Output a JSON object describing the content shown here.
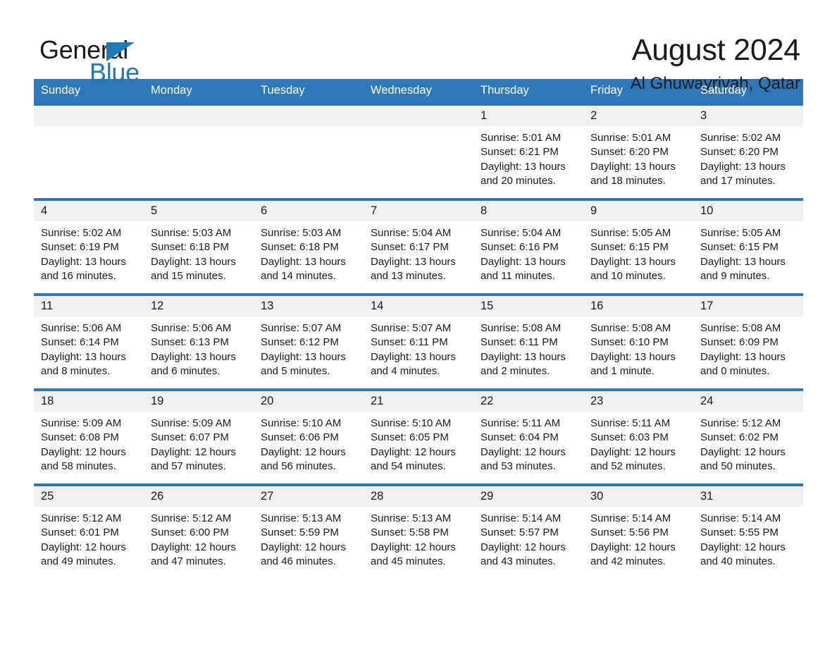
{
  "brand": {
    "name_top": "General",
    "name_bottom": "Blue",
    "accent_color": "#1f78b8"
  },
  "header": {
    "month_title": "August 2024",
    "location": "Al Ghuwayriyah, Qatar"
  },
  "calendar": {
    "header_bg": "#2e77b8",
    "header_text_color": "#ffffff",
    "daynum_bg": "#f0f0f0",
    "weekday_headers": [
      "Sunday",
      "Monday",
      "Tuesday",
      "Wednesday",
      "Thursday",
      "Friday",
      "Saturday"
    ],
    "weeks": [
      [
        {
          "day": "",
          "sunrise": "",
          "sunset": "",
          "daylight": ""
        },
        {
          "day": "",
          "sunrise": "",
          "sunset": "",
          "daylight": ""
        },
        {
          "day": "",
          "sunrise": "",
          "sunset": "",
          "daylight": ""
        },
        {
          "day": "",
          "sunrise": "",
          "sunset": "",
          "daylight": ""
        },
        {
          "day": "1",
          "sunrise": "Sunrise: 5:01 AM",
          "sunset": "Sunset: 6:21 PM",
          "daylight": "Daylight: 13 hours and 20 minutes."
        },
        {
          "day": "2",
          "sunrise": "Sunrise: 5:01 AM",
          "sunset": "Sunset: 6:20 PM",
          "daylight": "Daylight: 13 hours and 18 minutes."
        },
        {
          "day": "3",
          "sunrise": "Sunrise: 5:02 AM",
          "sunset": "Sunset: 6:20 PM",
          "daylight": "Daylight: 13 hours and 17 minutes."
        }
      ],
      [
        {
          "day": "4",
          "sunrise": "Sunrise: 5:02 AM",
          "sunset": "Sunset: 6:19 PM",
          "daylight": "Daylight: 13 hours and 16 minutes."
        },
        {
          "day": "5",
          "sunrise": "Sunrise: 5:03 AM",
          "sunset": "Sunset: 6:18 PM",
          "daylight": "Daylight: 13 hours and 15 minutes."
        },
        {
          "day": "6",
          "sunrise": "Sunrise: 5:03 AM",
          "sunset": "Sunset: 6:18 PM",
          "daylight": "Daylight: 13 hours and 14 minutes."
        },
        {
          "day": "7",
          "sunrise": "Sunrise: 5:04 AM",
          "sunset": "Sunset: 6:17 PM",
          "daylight": "Daylight: 13 hours and 13 minutes."
        },
        {
          "day": "8",
          "sunrise": "Sunrise: 5:04 AM",
          "sunset": "Sunset: 6:16 PM",
          "daylight": "Daylight: 13 hours and 11 minutes."
        },
        {
          "day": "9",
          "sunrise": "Sunrise: 5:05 AM",
          "sunset": "Sunset: 6:15 PM",
          "daylight": "Daylight: 13 hours and 10 minutes."
        },
        {
          "day": "10",
          "sunrise": "Sunrise: 5:05 AM",
          "sunset": "Sunset: 6:15 PM",
          "daylight": "Daylight: 13 hours and 9 minutes."
        }
      ],
      [
        {
          "day": "11",
          "sunrise": "Sunrise: 5:06 AM",
          "sunset": "Sunset: 6:14 PM",
          "daylight": "Daylight: 13 hours and 8 minutes."
        },
        {
          "day": "12",
          "sunrise": "Sunrise: 5:06 AM",
          "sunset": "Sunset: 6:13 PM",
          "daylight": "Daylight: 13 hours and 6 minutes."
        },
        {
          "day": "13",
          "sunrise": "Sunrise: 5:07 AM",
          "sunset": "Sunset: 6:12 PM",
          "daylight": "Daylight: 13 hours and 5 minutes."
        },
        {
          "day": "14",
          "sunrise": "Sunrise: 5:07 AM",
          "sunset": "Sunset: 6:11 PM",
          "daylight": "Daylight: 13 hours and 4 minutes."
        },
        {
          "day": "15",
          "sunrise": "Sunrise: 5:08 AM",
          "sunset": "Sunset: 6:11 PM",
          "daylight": "Daylight: 13 hours and 2 minutes."
        },
        {
          "day": "16",
          "sunrise": "Sunrise: 5:08 AM",
          "sunset": "Sunset: 6:10 PM",
          "daylight": "Daylight: 13 hours and 1 minute."
        },
        {
          "day": "17",
          "sunrise": "Sunrise: 5:08 AM",
          "sunset": "Sunset: 6:09 PM",
          "daylight": "Daylight: 13 hours and 0 minutes."
        }
      ],
      [
        {
          "day": "18",
          "sunrise": "Sunrise: 5:09 AM",
          "sunset": "Sunset: 6:08 PM",
          "daylight": "Daylight: 12 hours and 58 minutes."
        },
        {
          "day": "19",
          "sunrise": "Sunrise: 5:09 AM",
          "sunset": "Sunset: 6:07 PM",
          "daylight": "Daylight: 12 hours and 57 minutes."
        },
        {
          "day": "20",
          "sunrise": "Sunrise: 5:10 AM",
          "sunset": "Sunset: 6:06 PM",
          "daylight": "Daylight: 12 hours and 56 minutes."
        },
        {
          "day": "21",
          "sunrise": "Sunrise: 5:10 AM",
          "sunset": "Sunset: 6:05 PM",
          "daylight": "Daylight: 12 hours and 54 minutes."
        },
        {
          "day": "22",
          "sunrise": "Sunrise: 5:11 AM",
          "sunset": "Sunset: 6:04 PM",
          "daylight": "Daylight: 12 hours and 53 minutes."
        },
        {
          "day": "23",
          "sunrise": "Sunrise: 5:11 AM",
          "sunset": "Sunset: 6:03 PM",
          "daylight": "Daylight: 12 hours and 52 minutes."
        },
        {
          "day": "24",
          "sunrise": "Sunrise: 5:12 AM",
          "sunset": "Sunset: 6:02 PM",
          "daylight": "Daylight: 12 hours and 50 minutes."
        }
      ],
      [
        {
          "day": "25",
          "sunrise": "Sunrise: 5:12 AM",
          "sunset": "Sunset: 6:01 PM",
          "daylight": "Daylight: 12 hours and 49 minutes."
        },
        {
          "day": "26",
          "sunrise": "Sunrise: 5:12 AM",
          "sunset": "Sunset: 6:00 PM",
          "daylight": "Daylight: 12 hours and 47 minutes."
        },
        {
          "day": "27",
          "sunrise": "Sunrise: 5:13 AM",
          "sunset": "Sunset: 5:59 PM",
          "daylight": "Daylight: 12 hours and 46 minutes."
        },
        {
          "day": "28",
          "sunrise": "Sunrise: 5:13 AM",
          "sunset": "Sunset: 5:58 PM",
          "daylight": "Daylight: 12 hours and 45 minutes."
        },
        {
          "day": "29",
          "sunrise": "Sunrise: 5:14 AM",
          "sunset": "Sunset: 5:57 PM",
          "daylight": "Daylight: 12 hours and 43 minutes."
        },
        {
          "day": "30",
          "sunrise": "Sunrise: 5:14 AM",
          "sunset": "Sunset: 5:56 PM",
          "daylight": "Daylight: 12 hours and 42 minutes."
        },
        {
          "day": "31",
          "sunrise": "Sunrise: 5:14 AM",
          "sunset": "Sunset: 5:55 PM",
          "daylight": "Daylight: 12 hours and 40 minutes."
        }
      ]
    ]
  }
}
